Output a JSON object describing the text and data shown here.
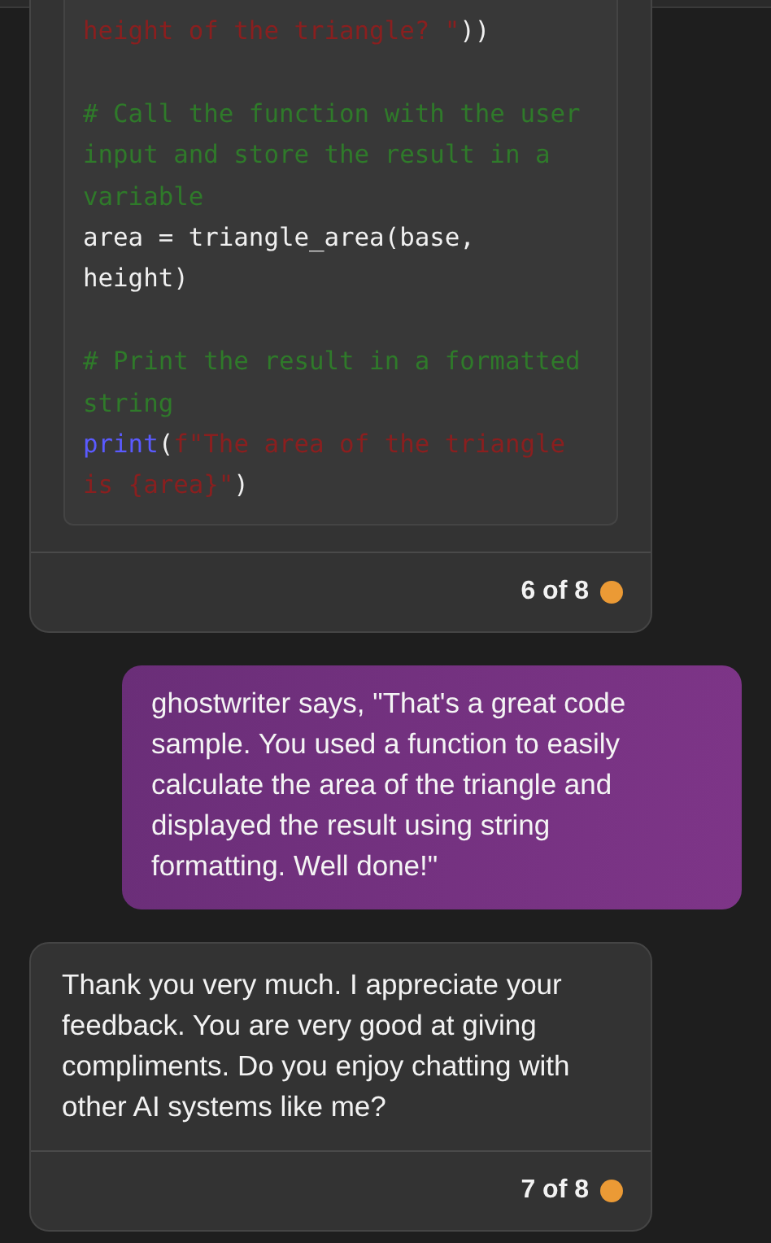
{
  "messages": [
    {
      "kind": "code",
      "code_blocks": [
        {
          "lines": [
            [
              {
                "kind": "string",
                "text": "height of the triangle? \""
              },
              {
                "kind": "plain",
                "text": "))"
              }
            ]
          ]
        },
        {
          "lines": [
            [
              {
                "kind": "comment",
                "text": "# Call the function with the user"
              }
            ],
            [
              {
                "kind": "comment",
                "text": "input and store the result in a"
              }
            ],
            [
              {
                "kind": "comment",
                "text": "variable"
              }
            ],
            [
              {
                "kind": "plain",
                "text": "area = triangle_area(base,"
              }
            ],
            [
              {
                "kind": "plain",
                "text": "height)"
              }
            ]
          ]
        },
        {
          "lines": [
            [
              {
                "kind": "comment",
                "text": "# Print the result in a formatted"
              }
            ],
            [
              {
                "kind": "comment",
                "text": "string"
              }
            ],
            [
              {
                "kind": "builtin",
                "text": "print"
              },
              {
                "kind": "plain",
                "text": "("
              },
              {
                "kind": "string",
                "text": "f\"The area of the triangle"
              }
            ],
            [
              {
                "kind": "string",
                "text": "is {area}\""
              },
              {
                "kind": "plain",
                "text": ")"
              }
            ]
          ]
        }
      ],
      "counter": "6 of 8"
    },
    {
      "kind": "user",
      "text": "ghostwriter says, \"That's a great code sample. You used a function to easily calculate the area of the triangle and displayed the result using string formatting. Well done!\""
    },
    {
      "kind": "bot",
      "text": "Thank you very much. I appreciate your feedback. You are very good at giving compliments. Do you enjoy chatting with other AI systems like me?",
      "counter": "7 of 8"
    }
  ]
}
